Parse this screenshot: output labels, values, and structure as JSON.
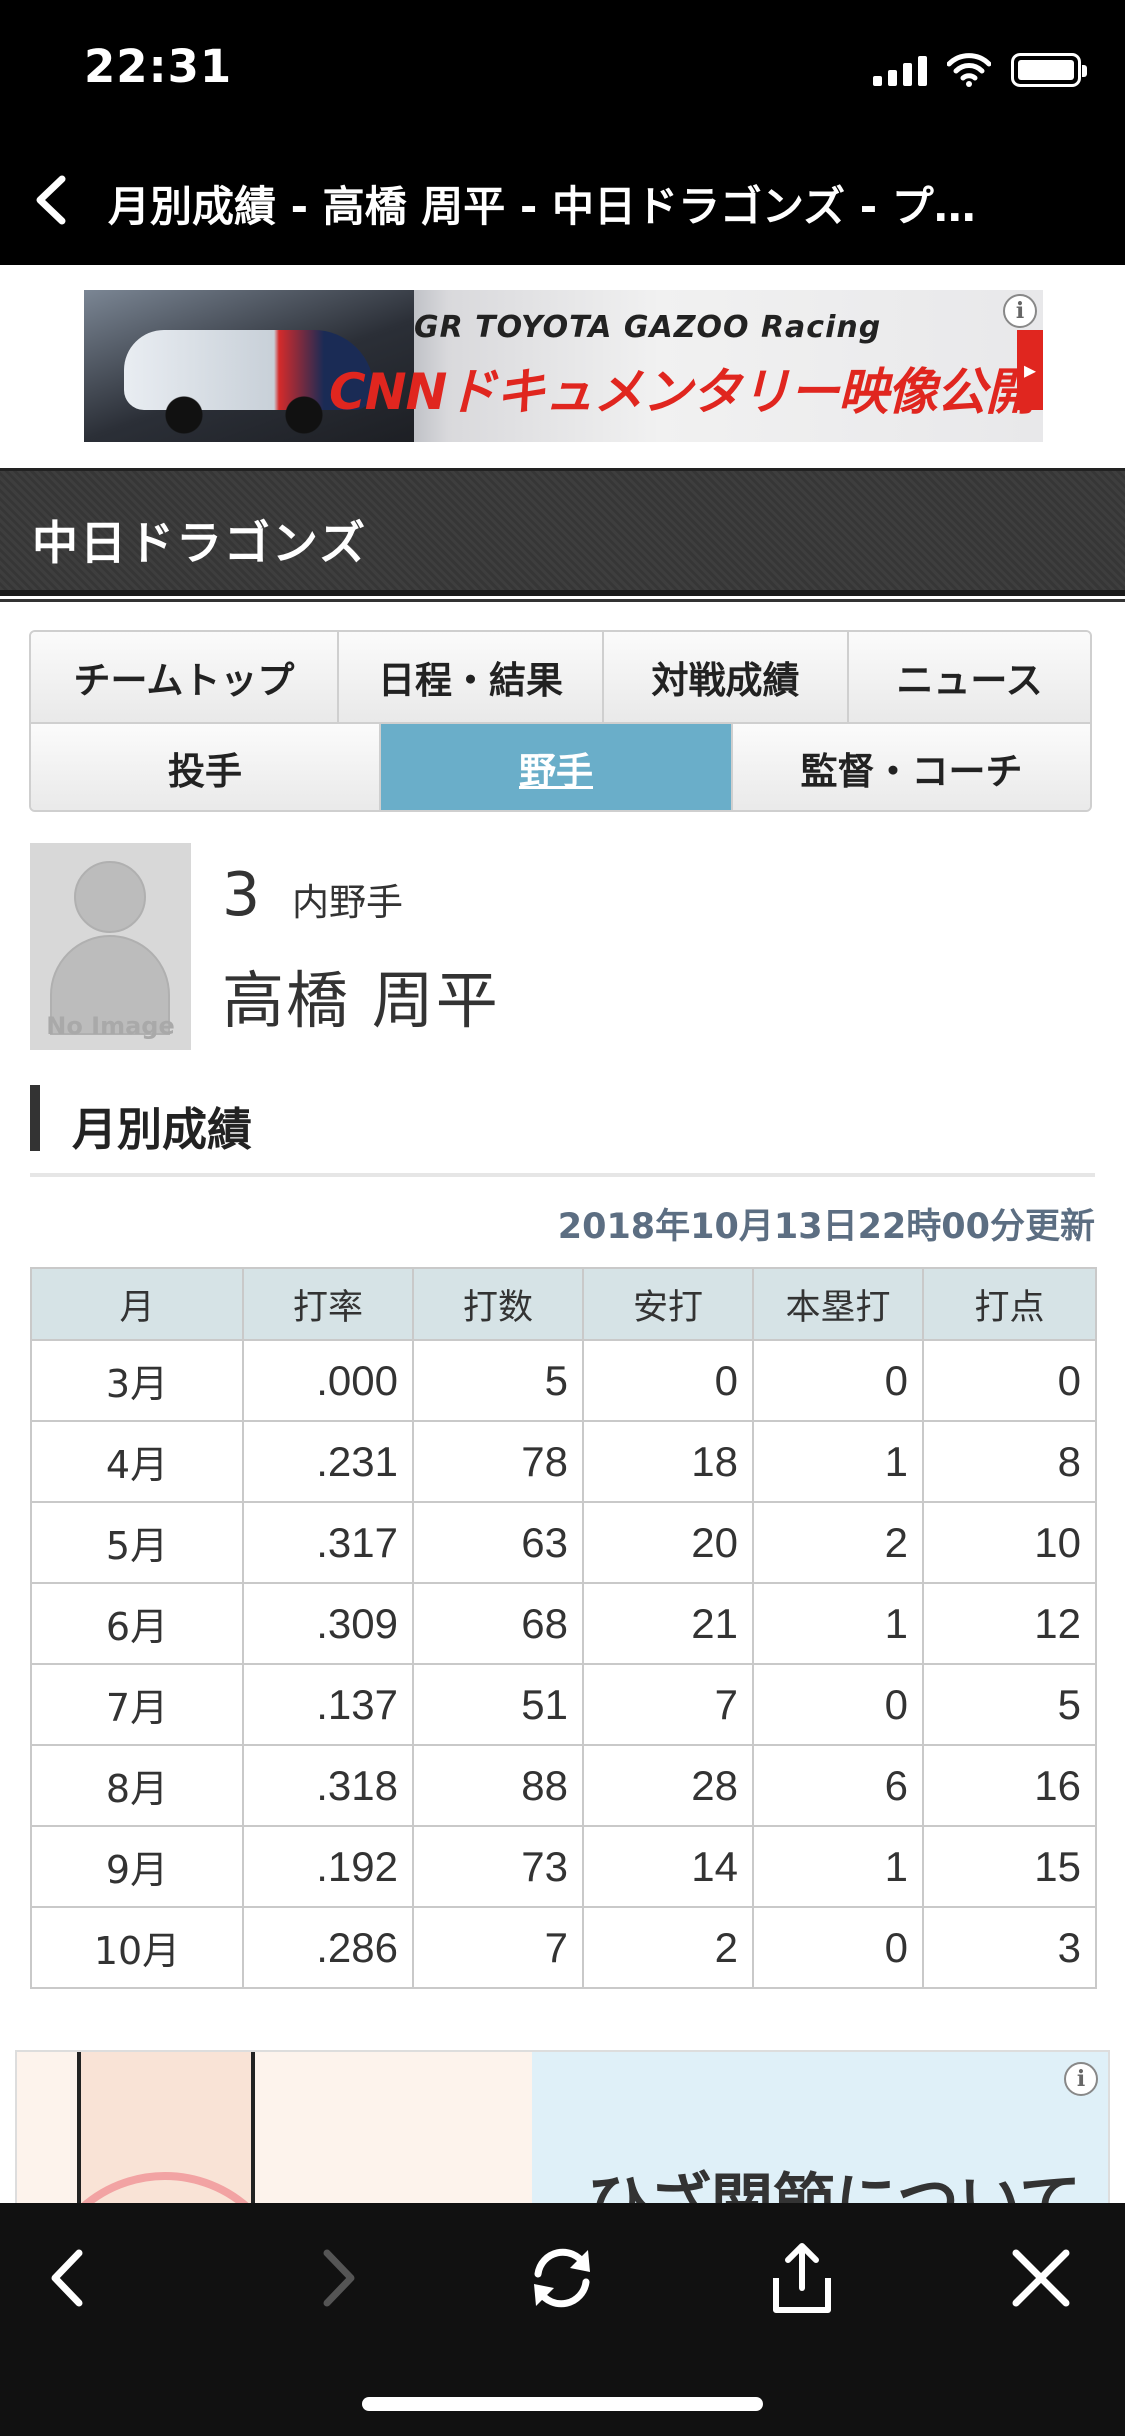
{
  "status_bar": {
    "time": "22:31"
  },
  "nav": {
    "title": "月別成績 - 高橋 周平 - 中日ドラゴンズ - プ…"
  },
  "ad_top": {
    "brand": "GR TOYOTA GAZOO Racing",
    "headline": "CNNドキュメンタリー映像公開中!"
  },
  "team": {
    "name": "中日ドラゴンズ"
  },
  "tabs": {
    "row1": [
      "チームトップ",
      "日程・結果",
      "対戦成績",
      "ニュース"
    ],
    "row2": [
      "投手",
      "野手",
      "監督・コーチ"
    ],
    "active": "野手"
  },
  "player": {
    "photo_label": "No Image",
    "number": "3",
    "position": "内野手",
    "name": "高橋 周平"
  },
  "section": {
    "title": "月別成績",
    "updated": "2018年10月13日22時00分更新"
  },
  "stats": {
    "headers": [
      "月",
      "打率",
      "打数",
      "安打",
      "本塁打",
      "打点"
    ],
    "rows": [
      [
        "3月",
        ".000",
        "5",
        "0",
        "0",
        "0"
      ],
      [
        "4月",
        ".231",
        "78",
        "18",
        "1",
        "8"
      ],
      [
        "5月",
        ".317",
        "63",
        "20",
        "2",
        "10"
      ],
      [
        "6月",
        ".309",
        "68",
        "21",
        "1",
        "12"
      ],
      [
        "7月",
        ".137",
        "51",
        "7",
        "0",
        "5"
      ],
      [
        "8月",
        ".318",
        "88",
        "28",
        "6",
        "16"
      ],
      [
        "9月",
        ".192",
        "73",
        "14",
        "1",
        "15"
      ],
      [
        "10月",
        ".286",
        "7",
        "2",
        "0",
        "3"
      ]
    ]
  },
  "ad_bottom": {
    "text": "ひざ関節について"
  },
  "colors": {
    "active_tab": "#6aaec9",
    "header_bg": "#3a3a3a",
    "table_header": "#d6e3e6",
    "updated_text": "#5c6e82",
    "ad_red": "#e0261f"
  },
  "icons": {
    "back": "chevron-left-icon",
    "forward": "chevron-right-icon",
    "reload": "reload-icon",
    "share": "share-icon",
    "close": "close-icon"
  }
}
